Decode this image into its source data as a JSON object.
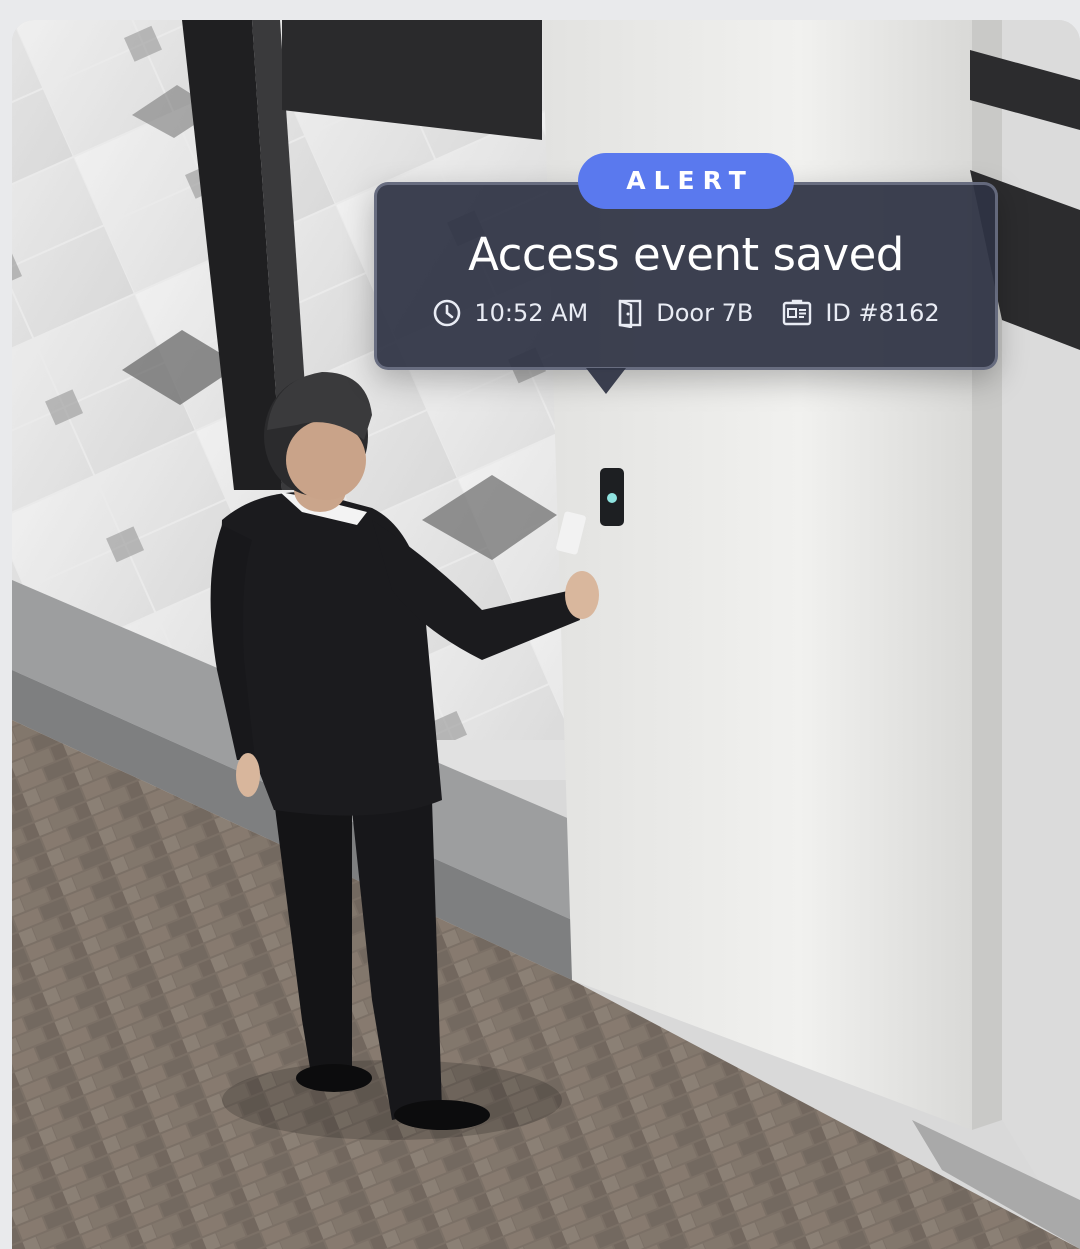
{
  "alert": {
    "badge": "ALERT",
    "title": "Access event saved",
    "time": "10:52 AM",
    "door": "Door 7B",
    "id": "ID #8162",
    "icons": [
      "clock-icon",
      "door-icon",
      "id-card-icon"
    ],
    "badge_color": "#5a79ee",
    "panel_color": "#2e3344"
  }
}
